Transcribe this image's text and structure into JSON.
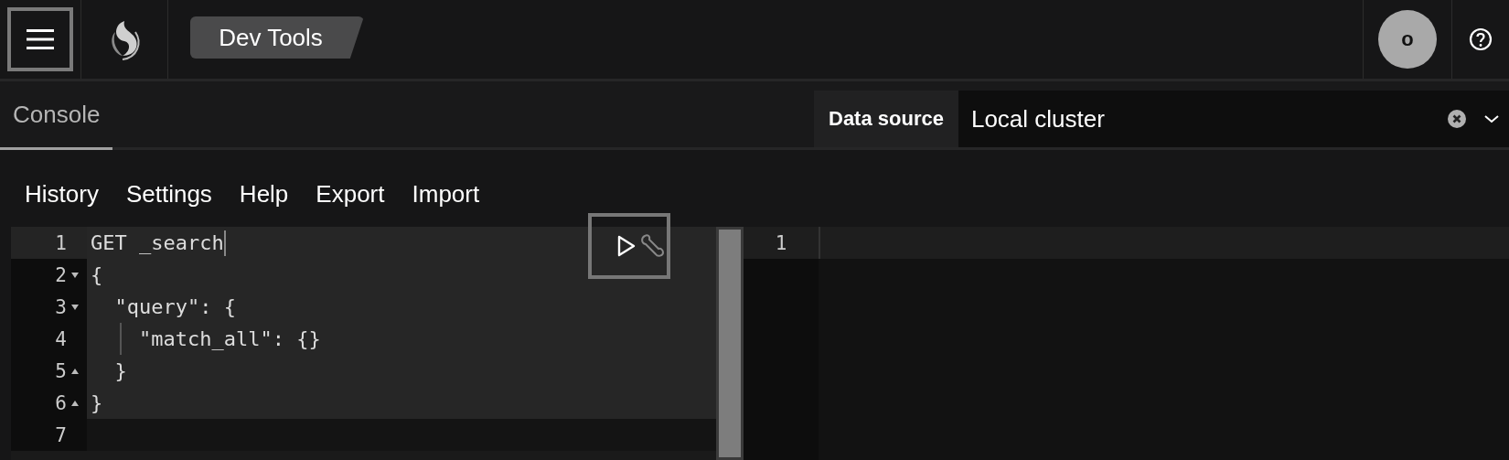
{
  "header": {
    "menu_button": {
      "highlighted": true
    },
    "breadcrumb": "Dev Tools",
    "avatar": "o"
  },
  "tabs": [
    {
      "label": "Console",
      "selected": true
    }
  ],
  "data_source": {
    "label": "Data source",
    "value": "Local cluster"
  },
  "menu": [
    "History",
    "Settings",
    "Help",
    "Export",
    "Import"
  ],
  "request_actions": {
    "highlighted": true
  },
  "editor": {
    "lines": [
      {
        "number": "1",
        "text": "GET _search",
        "kind": "plain",
        "active": true,
        "highlighted": true,
        "guide": false
      },
      {
        "number": "2",
        "text": "{",
        "kind": "fold-start",
        "active": false,
        "highlighted": true,
        "guide": false
      },
      {
        "number": "3",
        "text": "  \"query\": {",
        "kind": "fold-start",
        "active": false,
        "highlighted": true,
        "guide": false
      },
      {
        "number": "4",
        "text": "    \"match_all\": {}",
        "kind": "plain",
        "active": false,
        "highlighted": true,
        "guide": true
      },
      {
        "number": "5",
        "text": "  }",
        "kind": "fold-end",
        "active": false,
        "highlighted": true,
        "guide": false
      },
      {
        "number": "6",
        "text": "}",
        "kind": "fold-end",
        "active": false,
        "highlighted": true,
        "guide": false
      },
      {
        "number": "7",
        "kind": "plain",
        "active": false,
        "highlighted": false,
        "guide": false
      }
    ]
  },
  "output": {
    "lines": [
      {
        "number": "1",
        "active": true
      }
    ]
  }
}
